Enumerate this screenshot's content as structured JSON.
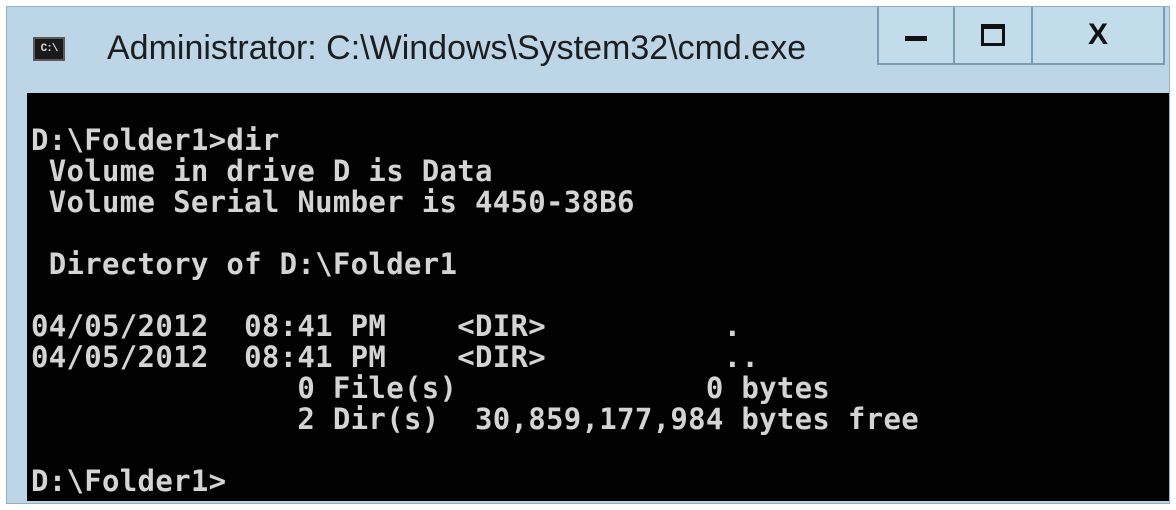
{
  "window": {
    "title": "Administrator: C:\\Windows\\System32\\cmd.exe",
    "icon_text": "C:\\",
    "icon": "cmd-icon",
    "controls": [
      "minimize-icon",
      "maximize-icon",
      "close-icon"
    ],
    "close_label": "X"
  },
  "console": {
    "lines": [
      "D:\\Folder1>dir",
      " Volume in drive D is Data",
      " Volume Serial Number is 4450-38B6",
      "",
      " Directory of D:\\Folder1",
      "",
      "04/05/2012  08:41 PM    <DIR>          .",
      "04/05/2012  08:41 PM    <DIR>          ..",
      "               0 File(s)              0 bytes",
      "               2 Dir(s)  30,859,177,984 bytes free",
      "",
      "D:\\Folder1>"
    ]
  },
  "colors": {
    "console_bg": "#020202",
    "console_fg": "#d4d4d4",
    "frame": "#bcd6e8"
  }
}
